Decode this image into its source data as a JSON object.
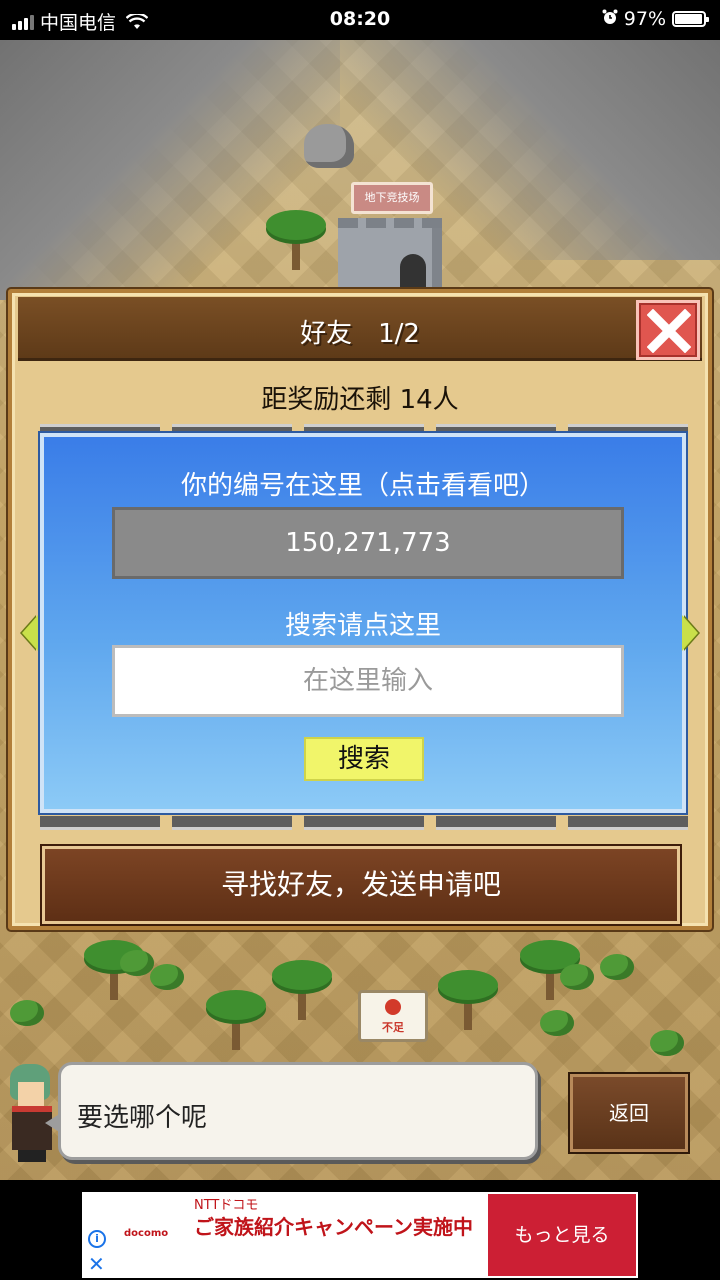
{
  "status_bar": {
    "carrier": "中国电信",
    "time": "08:20",
    "battery": "97%",
    "battery_level": 0.97,
    "signal_icon": "signal-bars-icon",
    "wifi_icon": "wifi-icon",
    "alarm_icon": "alarm-clock-icon"
  },
  "scene": {
    "building_sign": "地下竞技场",
    "item_sign": "不足"
  },
  "friends_dialog": {
    "title": "好友　1/2",
    "close_icon": "close-x-icon",
    "reward_text": "距奖励还剩 14人",
    "id_label": "你的编号在这里（点击看看吧）",
    "player_id": "150,271,773",
    "search_label": "搜索请点这里",
    "search_placeholder": "在这里输入",
    "search_button": "搜索",
    "find_button": "寻找好友，发送申请吧",
    "prev_icon": "arrow-left-icon",
    "next_icon": "arrow-right-icon",
    "colors": {
      "header": "#6b4420",
      "blue_panel": "#4a8ae9",
      "search_button": "#f1f56a",
      "close_button": "#e0564f"
    }
  },
  "dialogue": {
    "speech": "要选哪个呢",
    "back_button": "返回"
  },
  "ad": {
    "brand": "docomo",
    "tagline": "NTTドコモ",
    "headline": "ご家族紹介キャンペーン実施中",
    "cta": "もっと見る",
    "info_icon": "info-icon",
    "close_icon": "close-icon"
  }
}
